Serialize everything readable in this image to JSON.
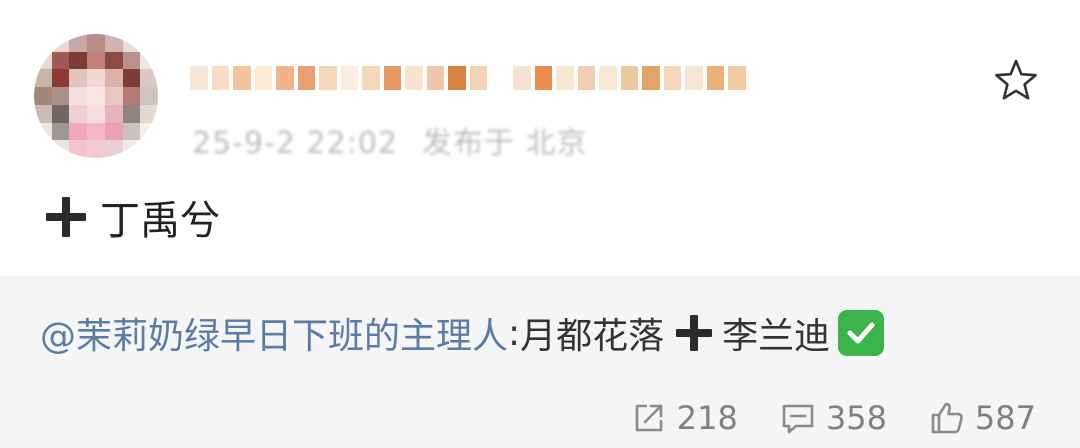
{
  "post": {
    "text": "丁禹兮",
    "meta_time": "25-9-2 22:02",
    "meta_location": "发布于 北京",
    "star_label": "收藏"
  },
  "repost": {
    "mention": "@茉莉奶绿早日下班的主理人",
    "separator": ":",
    "text_before": "月都花落",
    "text_after": "李兰迪"
  },
  "actions": {
    "share_count": "218",
    "comment_count": "358",
    "like_count": "587"
  },
  "icons": {
    "star": "star-outline-icon",
    "plus": "heavy-plus-icon",
    "check": "green-check-box-icon",
    "share": "share-arrow-icon",
    "comment": "comment-bubble-icon",
    "like": "thumbs-up-icon"
  },
  "colors": {
    "mention": "#5b7ca6",
    "repost_bg": "#f5f5f5",
    "count": "#808080",
    "check": "#3bb54a"
  }
}
